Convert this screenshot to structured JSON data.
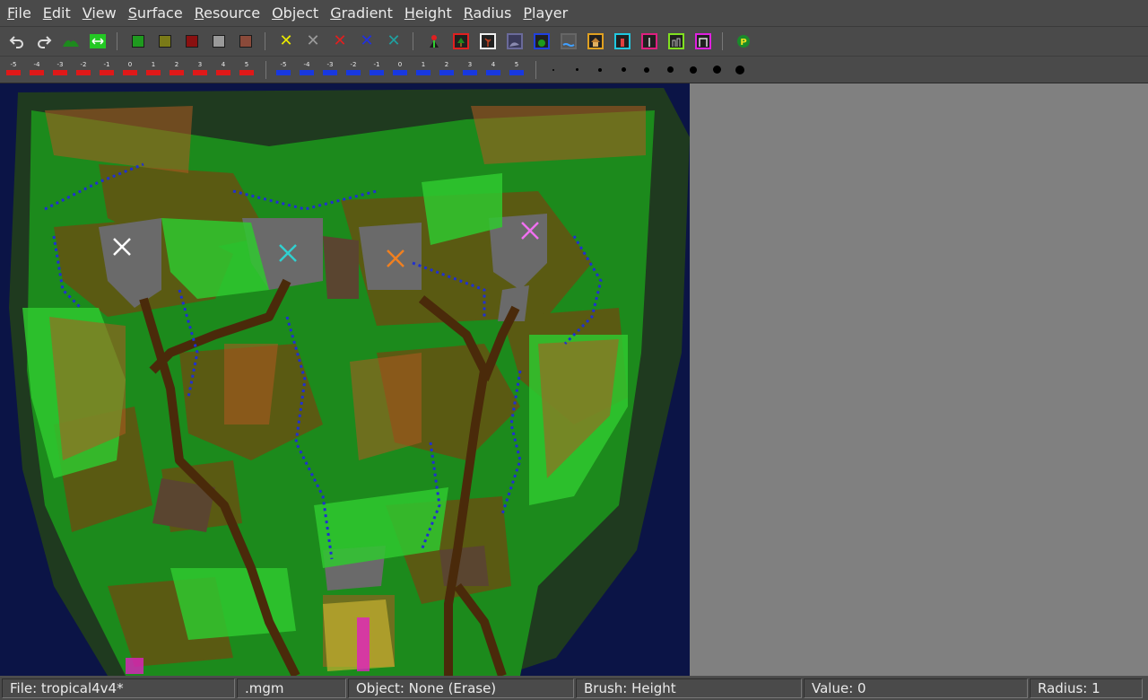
{
  "menu": [
    "File",
    "Edit",
    "View",
    "Surface",
    "Resource",
    "Object",
    "Gradient",
    "Height",
    "Radius",
    "Player"
  ],
  "menu_underline_index": [
    0,
    0,
    0,
    0,
    0,
    0,
    0,
    0,
    0,
    0
  ],
  "height_labels_red": [
    "-5",
    "-4",
    "-3",
    "-2",
    "-1",
    "0",
    "1",
    "2",
    "3",
    "4",
    "5"
  ],
  "height_labels_blue": [
    "-5",
    "-4",
    "-3",
    "-2",
    "-1",
    "0",
    "1",
    "2",
    "3",
    "4",
    "5"
  ],
  "colors": {
    "surface_green": "#1f9a1f",
    "surface_olive": "#8a8a1a",
    "surface_red": "#8a1111",
    "surface_gray": "#9a9a9a",
    "surface_brown": "#8a4a3a",
    "player_yellow": "#e8e800",
    "player_gray": "#9a9a9a",
    "player_red": "#e02020",
    "player_blue": "#2020e0",
    "player_teal": "#20a0a0",
    "water": "#0b1446",
    "panel_gray": "#808080"
  },
  "map": {
    "start_markers": [
      {
        "color": "#ffffff"
      },
      {
        "color": "#30d0d0"
      },
      {
        "color": "#f08020"
      },
      {
        "color": "#f070f0"
      }
    ]
  },
  "status": {
    "file": "File: tropical4v4*",
    "ext": ".mgm",
    "object": "Object: None (Erase)",
    "brush": "Brush: Height",
    "value": "Value: 0",
    "radius": "Radius: 1"
  }
}
